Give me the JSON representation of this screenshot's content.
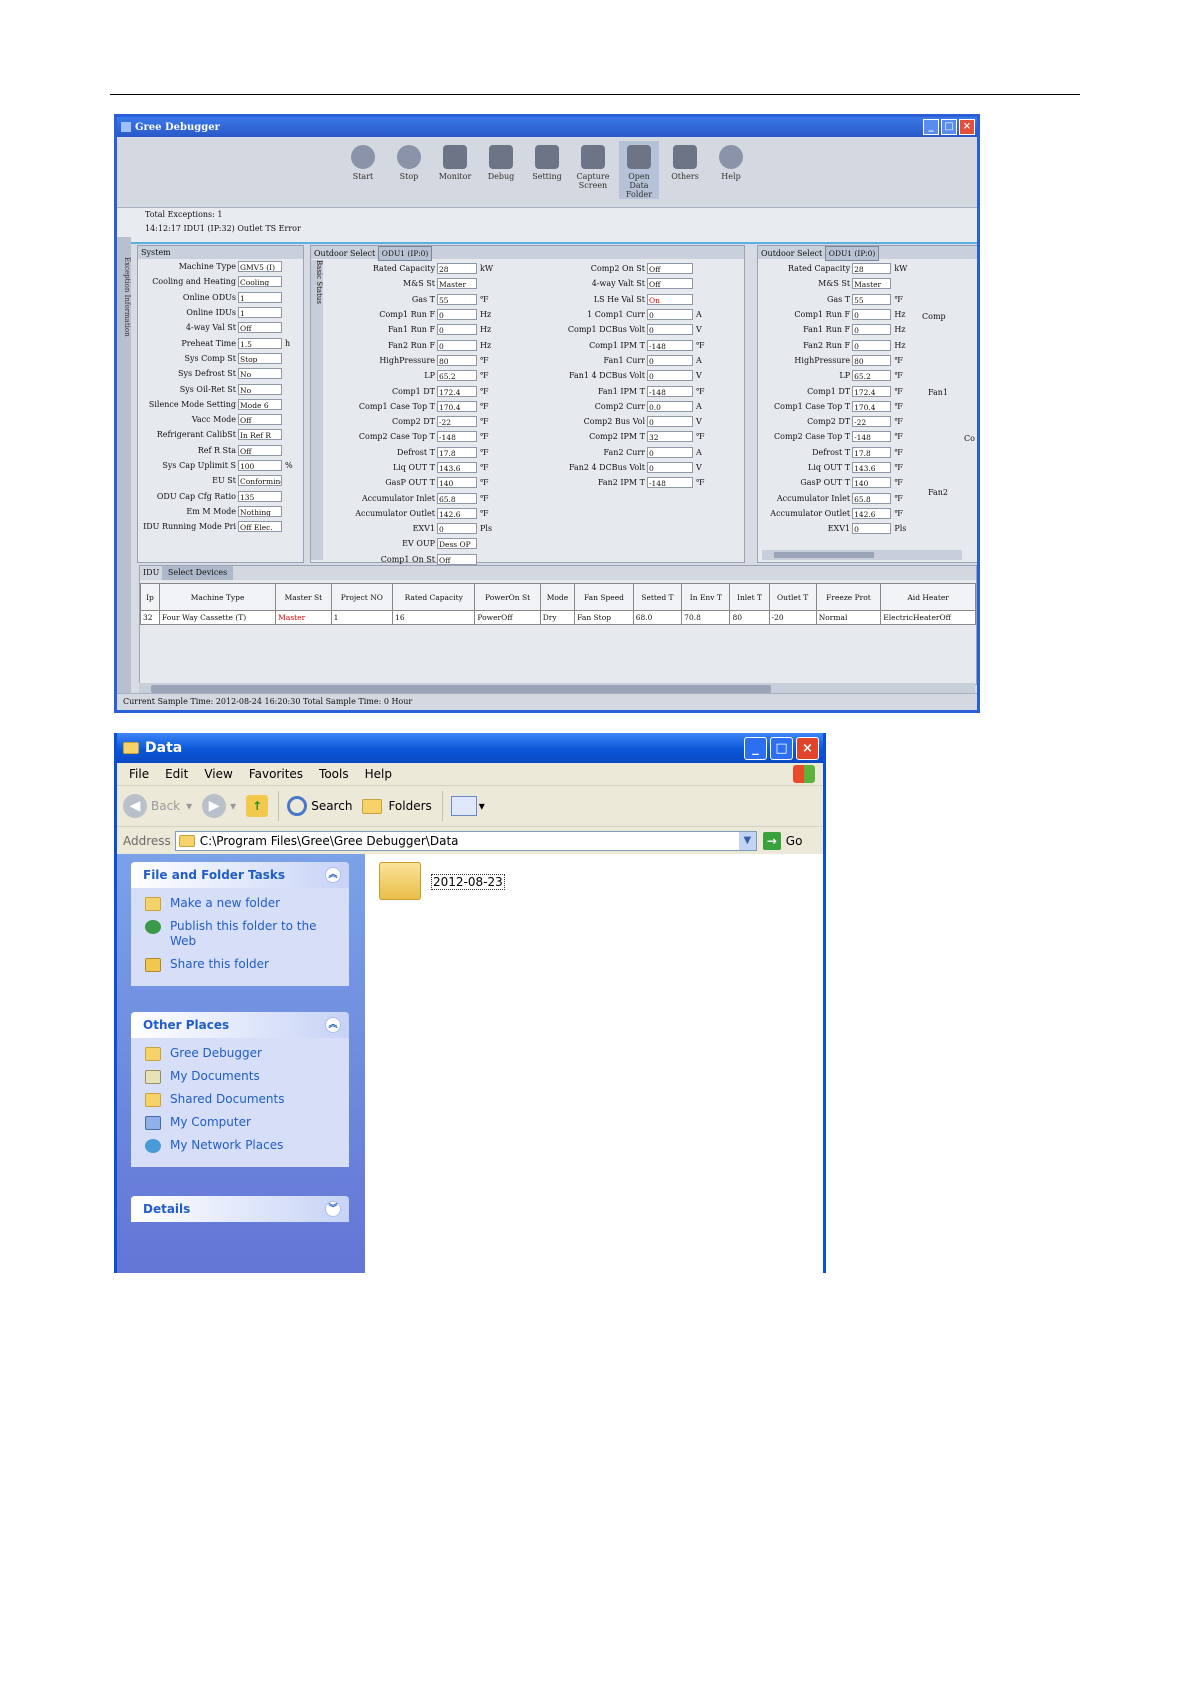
{
  "debugger": {
    "title": "Gree Debugger",
    "toolbar": [
      "Start",
      "Stop",
      "Monitor",
      "Debug",
      "Setting",
      "Capture Screen",
      "Open Data Folder",
      "Others",
      "Help"
    ],
    "total_exceptions": "Total Exceptions: 1",
    "exception_line": "14:12:17 IDU1 (IP:32) Outlet TS Error",
    "left_strip": "Exception Information",
    "system": {
      "header": "System",
      "rows": [
        {
          "label": "Machine Type",
          "value": "GMV5 (I)",
          "unit": ""
        },
        {
          "label": "Cooling and Heating",
          "value": "Cooling",
          "unit": ""
        },
        {
          "label": "Online ODUs",
          "value": "1",
          "unit": ""
        },
        {
          "label": "Online IDUs",
          "value": "1",
          "unit": ""
        },
        {
          "label": "4-way Val St",
          "value": "Off",
          "unit": ""
        },
        {
          "label": "Preheat Time",
          "value": "1.5",
          "unit": "h"
        },
        {
          "label": "Sys Comp St",
          "value": "Stop",
          "unit": ""
        },
        {
          "label": "Sys Defrost St",
          "value": "No",
          "unit": ""
        },
        {
          "label": "Sys Oil-Ret St",
          "value": "No",
          "unit": ""
        },
        {
          "label": "Silence Mode Setting",
          "value": "Mode 6",
          "unit": ""
        },
        {
          "label": "Vacc Mode",
          "value": "Off",
          "unit": ""
        },
        {
          "label": "Refrigerant CalibSt",
          "value": "In Ref R",
          "unit": ""
        },
        {
          "label": "Ref R Sta",
          "value": "Off",
          "unit": ""
        },
        {
          "label": "Sys Cap Uplimit S",
          "value": "100",
          "unit": "%"
        },
        {
          "label": "EU St",
          "value": "Conforming",
          "unit": ""
        },
        {
          "label": "ODU Cap Cfg Ratio",
          "value": "135",
          "unit": ""
        },
        {
          "label": "Em M Mode",
          "value": "Nothing",
          "unit": ""
        },
        {
          "label": "IDU Running Mode Pri",
          "value": "Off Elec.",
          "unit": ""
        }
      ]
    },
    "outdoor_a": {
      "select_label": "Outdoor Select",
      "select_value": "ODU1 (IP:0)",
      "side_label": "Basic Status",
      "rows_left": [
        {
          "label": "Rated Capacity",
          "value": "28",
          "unit": "kW"
        },
        {
          "label": "M&S St",
          "value": "Master",
          "unit": ""
        },
        {
          "label": "Gas T",
          "value": "55",
          "unit": "℉"
        },
        {
          "label": "Comp1 Run F",
          "value": "0",
          "unit": "Hz"
        },
        {
          "label": "Fan1 Run F",
          "value": "0",
          "unit": "Hz"
        },
        {
          "label": "Fan2 Run F",
          "value": "0",
          "unit": "Hz"
        },
        {
          "label": "HighPressure",
          "value": "80",
          "unit": "℉"
        },
        {
          "label": "LP",
          "value": "65.2",
          "unit": "℉"
        },
        {
          "label": "Comp1 DT",
          "value": "172.4",
          "unit": "℉"
        },
        {
          "label": "Comp1 Case Top T",
          "value": "170.4",
          "unit": "℉"
        },
        {
          "label": "Comp2 DT",
          "value": "-22",
          "unit": "℉"
        },
        {
          "label": "Comp2 Case Top T",
          "value": "-148",
          "unit": "℉"
        },
        {
          "label": "Defrost T",
          "value": "17.8",
          "unit": "℉"
        },
        {
          "label": "Liq OUT T",
          "value": "143.6",
          "unit": "℉"
        },
        {
          "label": "GasP OUT T",
          "value": "140",
          "unit": "℉"
        },
        {
          "label": "Accumulator Inlet",
          "value": "65.8",
          "unit": "℉"
        },
        {
          "label": "Accumulator Outlet",
          "value": "142.6",
          "unit": "℉"
        },
        {
          "label": "EXV1",
          "value": "0",
          "unit": "Pls"
        },
        {
          "label": "EV OUP",
          "value": "Dess OP",
          "unit": ""
        },
        {
          "label": "Comp1 On St",
          "value": "Off",
          "unit": ""
        }
      ],
      "rows_right": [
        {
          "label": "Comp2 On St",
          "value": "Off",
          "unit": ""
        },
        {
          "label": "4-way Valt St",
          "value": "Off",
          "unit": ""
        },
        {
          "label": "LS He Val St",
          "value": "On",
          "unit": "",
          "red": true
        },
        {
          "label": "1 Comp1 Curr",
          "value": "0",
          "unit": "A"
        },
        {
          "label": "Comp1 DCBus Volt",
          "value": "0",
          "unit": "V"
        },
        {
          "label": "Comp1 IPM T",
          "value": "-148",
          "unit": "℉"
        },
        {
          "label": "Fan1 Curr",
          "value": "0",
          "unit": "A"
        },
        {
          "label": "Fan1 4 DCBus Volt",
          "value": "0",
          "unit": "V"
        },
        {
          "label": "Fan1 IPM T",
          "value": "-148",
          "unit": "℉"
        },
        {
          "label": "Comp2 Curr",
          "value": "0.0",
          "unit": "A"
        },
        {
          "label": "Comp2 Bus Vol",
          "value": "0",
          "unit": "V"
        },
        {
          "label": "Comp2 IPM T",
          "value": "32",
          "unit": "℉"
        },
        {
          "label": "Fan2 Curr",
          "value": "0",
          "unit": "A"
        },
        {
          "label": "Fan2 4 DCBus Volt",
          "value": "0",
          "unit": "V"
        },
        {
          "label": "Fan2 IPM T",
          "value": "-148",
          "unit": "℉"
        }
      ]
    },
    "outdoor_b": {
      "select_label": "Outdoor Select",
      "select_value": "ODU1 (IP:0)",
      "rows": [
        {
          "label": "Rated Capacity",
          "value": "28",
          "unit": "kW"
        },
        {
          "label": "M&S St",
          "value": "Master",
          "unit": ""
        },
        {
          "label": "Gas T",
          "value": "55",
          "unit": "℉"
        },
        {
          "label": "Comp1 Run F",
          "value": "0",
          "unit": "Hz"
        },
        {
          "label": "Fan1 Run F",
          "value": "0",
          "unit": "Hz"
        },
        {
          "label": "Fan2 Run F",
          "value": "0",
          "unit": "Hz"
        },
        {
          "label": "HighPressure",
          "value": "80",
          "unit": "℉"
        },
        {
          "label": "LP",
          "value": "65.2",
          "unit": "℉"
        },
        {
          "label": "Comp1 DT",
          "value": "172.4",
          "unit": "℉"
        },
        {
          "label": "Comp1 Case Top T",
          "value": "170.4",
          "unit": "℉"
        },
        {
          "label": "Comp2 DT",
          "value": "-22",
          "unit": "℉"
        },
        {
          "label": "Comp2 Case Top T",
          "value": "-148",
          "unit": "℉"
        },
        {
          "label": "Defrost T",
          "value": "17.8",
          "unit": "℉"
        },
        {
          "label": "Liq OUT T",
          "value": "143.6",
          "unit": "℉"
        },
        {
          "label": "GasP OUT T",
          "value": "140",
          "unit": "℉"
        },
        {
          "label": "Accumulator Inlet",
          "value": "65.8",
          "unit": "℉"
        },
        {
          "label": "Accumulator Outlet",
          "value": "142.6",
          "unit": "℉"
        },
        {
          "label": "EXV1",
          "value": "0",
          "unit": "Pls"
        }
      ],
      "cutoff": [
        "Comp",
        "Fan1",
        "Co",
        "Fan2"
      ]
    },
    "idu": {
      "label": "IDU",
      "tab": "Select Devices",
      "headers": [
        "Ip",
        "Machine Type",
        "Master St",
        "Project NO",
        "Rated Capacity",
        "PowerOn St",
        "Mode",
        "Fan Speed",
        "Setted T",
        "In Env T",
        "Inlet T",
        "Outlet T",
        "Freeze Prot",
        "Aid Heater"
      ],
      "row": [
        "32",
        "Four Way Cassette (T)",
        "Master",
        "1",
        "16",
        "PowerOff",
        "Dry",
        "Fan Stop",
        "68.0",
        "70.8",
        "80",
        "-20",
        "Normal",
        "ElectricHeaterOff"
      ]
    },
    "status": "Current Sample Time: 2012-08-24 16:20:30  Total Sample Time: 0 Hour"
  },
  "explorer": {
    "title": "Data",
    "menu": [
      "File",
      "Edit",
      "View",
      "Favorites",
      "Tools",
      "Help"
    ],
    "toolbar": {
      "back": "Back",
      "search": "Search",
      "folders": "Folders"
    },
    "address_label": "Address",
    "address": "C:\\Program Files\\Gree\\Gree Debugger\\Data",
    "go": "Go",
    "file_tasks": {
      "title": "File and Folder Tasks",
      "items": [
        "Make a new folder",
        "Publish this folder to the Web",
        "Share this folder"
      ]
    },
    "other_places": {
      "title": "Other Places",
      "items": [
        "Gree Debugger",
        "My Documents",
        "Shared Documents",
        "My Computer",
        "My Network Places"
      ]
    },
    "details": {
      "title": "Details"
    },
    "folder_name": "2012-08-23"
  }
}
